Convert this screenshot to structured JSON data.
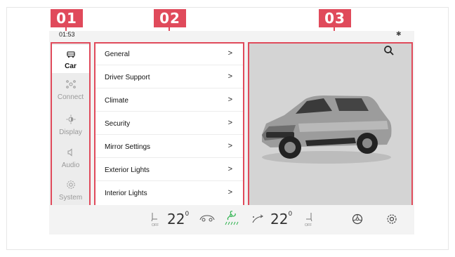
{
  "badges": {
    "b1": "01",
    "b2": "02",
    "b3": "03"
  },
  "status": {
    "time": "01:53",
    "bluetooth_icon": "bluetooth-icon"
  },
  "sidebar": {
    "items": [
      {
        "label": "Car",
        "icon": "car-icon",
        "active": true
      },
      {
        "label": "Connect",
        "icon": "connect-icon",
        "active": false
      },
      {
        "label": "Display",
        "icon": "brightness-icon",
        "active": false
      },
      {
        "label": "Audio",
        "icon": "speaker-icon",
        "active": false
      },
      {
        "label": "System",
        "icon": "gear-icon",
        "active": false
      }
    ]
  },
  "menu": {
    "items": [
      {
        "label": "General",
        "chevron": ">"
      },
      {
        "label": "Driver Support",
        "chevron": ">"
      },
      {
        "label": "Climate",
        "chevron": ">"
      },
      {
        "label": "Security",
        "chevron": ">"
      },
      {
        "label": "Mirror Settings",
        "chevron": ">"
      },
      {
        "label": "Exterior Lights",
        "chevron": ">"
      },
      {
        "label": "Interior Lights",
        "chevron": ">"
      }
    ]
  },
  "car_panel": {
    "search_icon": "search-icon"
  },
  "bottom_bar": {
    "left_seat_label": "OFF",
    "left_temp": "22",
    "left_temp_decimal": "0",
    "right_temp": "22",
    "right_temp_decimal": "0",
    "right_seat_label": "OFF",
    "fan_icon": "fan-icon",
    "recirculation_icon": "recirculation-icon",
    "airflow_icon": "airflow-icon",
    "steering_icon": "steering-wheel-icon",
    "settings_icon": "gear-icon"
  },
  "colors": {
    "accent": "#e04a5b",
    "fan_green": "#2bb24c"
  }
}
